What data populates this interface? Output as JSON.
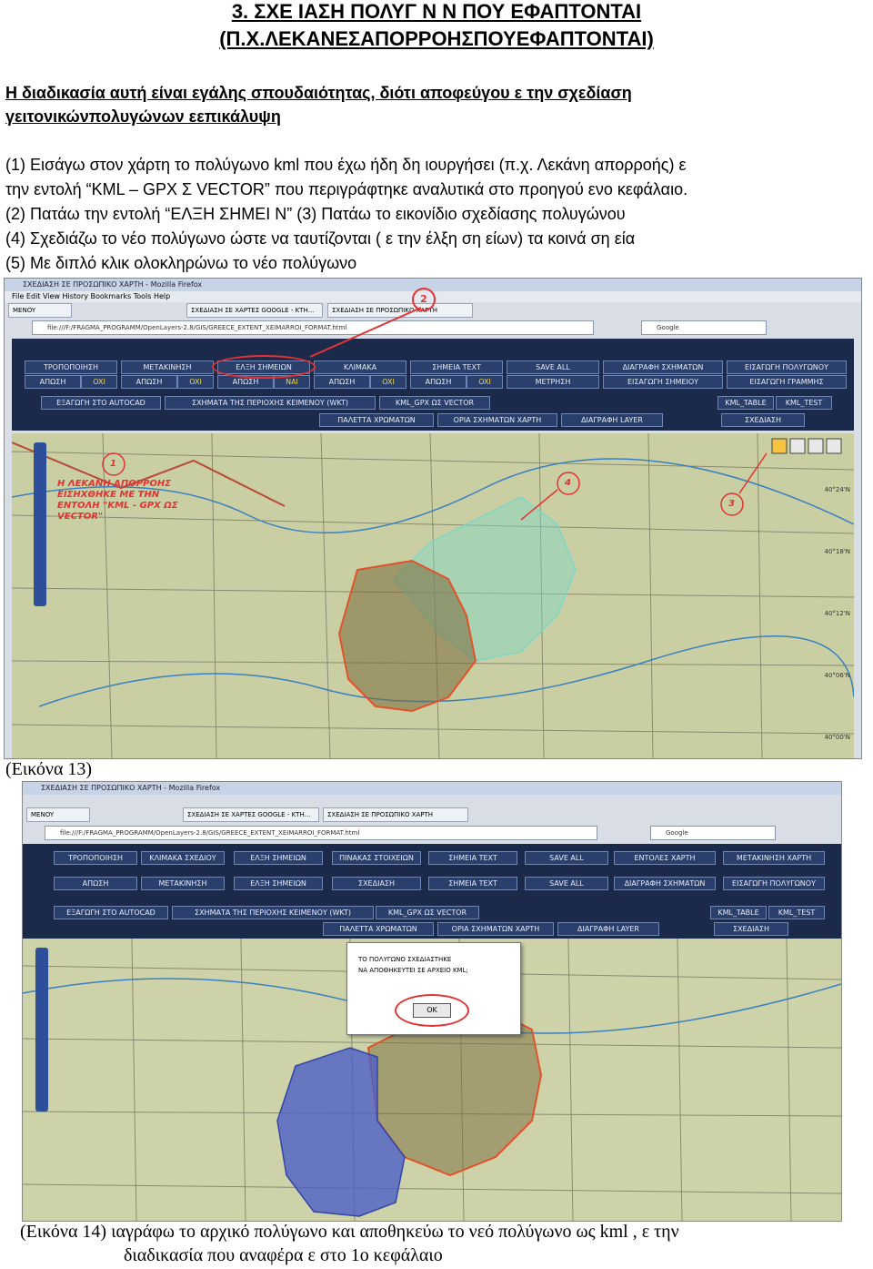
{
  "title": {
    "line1": "3. ΣΧΕ ΙΑΣΗ ΠΟΛΥΓ Ν Ν ΠΟΥ ΕΦΑΠΤΟΝΤΑΙ",
    "line2": "(Π.Χ.ΛΕΚΑΝΕΣΑΠΟΡΡΟΗΣΠΟΥΕΦΑΠΤΟΝΤΑΙ)"
  },
  "intro": {
    "line1": "Η διαδικασία αυτή είναι εγάλης σπουδαιότητας, διότι αποφεύγου ε την σχεδίαση",
    "line2": "γειτονικώνπολυγώνων εεπικάλυψη"
  },
  "steps": {
    "s1a": "(1) Εισάγω στον χάρτη το πολύγωνο kml που έχω ήδη δη ιουργήσει (π.χ. Λεκάνη απορροής) ε",
    "s1b": "την εντολή “KML – GPX Σ VECTOR” που περιγράφτηκε αναλυτικά στο προηγού ενο κεφάλαιο.",
    "s2": "(2) Πατάω την εντολή “ΕΛΞΗ ΣΗΜΕΙ Ν” (3) Πατάω το εικονίδιο σχεδίασης πολυγώνου",
    "s4": "(4) Σχεδιάζω το νέο πολύγωνο ώστε να ταυτίζονται ( ε την έλξη ση είων) τα κοινά ση εία",
    "s5": "(5) Με διπλό κλικ ολοκληρώνω το νέο πολύγωνο"
  },
  "shot1": {
    "window_title": "ΣΧΕΔΙΑΣΗ ΣΕ ΠΡΟΣΩΠΙΚΟ ΧΑΡΤΗ - Mozilla Firefox",
    "menu": "File  Edit  View  History  Bookmarks  Tools  Help",
    "tabs": [
      "MENOY",
      "ΣΧΕΔΙΑΣΗ ΣΕ ΧΑΡΤΕΣ GOOGLE - ΚΤΗ...",
      "ΣΧΕΔΙΑΣΗ ΣΕ ΠΡΟΣΩΠΙΚΟ ΧΑΡΤΗ"
    ],
    "url": "file:///F:/FRAGMA_PROGRAMM/OpenLayers-2.8/GIS/GREECE_EXTENT_XEIMARROI_FORMAT.html",
    "search_placeholder": "Google",
    "row1": [
      "ΤΡΟΠΟΠΟΙΗΣΗ",
      "ΜΕΤΑΚΙΝΗΣΗ",
      "ΕΛΞΗ ΣΗΜΕΙΩΝ",
      "ΚΛΙΜΑΚΑ",
      "ΣΗΜΕΙΑ TEXT",
      "SAVE ALL",
      "ΔΙΑΓΡΑΦΗ ΣΧΗΜΑΤΩΝ",
      "ΕΙΣΑΓΩΓΗ ΠΟΛΥΓΩΝΟΥ"
    ],
    "row2": [
      "ΑΠΩΣΗ",
      "ΑΠΩΣΗ",
      "ΑΠΩΣΗ",
      "ΑΠΩΣΗ",
      "ΑΠΩΣΗ",
      "ΜΕΤΡΗΣΗ",
      "ΕΙΣΑΓΩΓΗ ΣΗΜΕΙΟΥ",
      "ΕΙΣΑΓΩΓΗ ΓΡΑΜΜΗΣ"
    ],
    "row2_values": [
      "OXI",
      "OXI",
      "NAI",
      "OXI",
      "OXI"
    ],
    "row3": [
      "ΕΞΑΓΩΓΗ ΣΤΟ AUTOCAD",
      "ΣΧΗΜΑΤΑ ΤΗΣ ΠΕΡΙΟΧΗΣ ΚΕΙΜΕΝΟΥ (WKT)",
      "KML_GPX ΩΣ VECTOR",
      "KML_TABLE",
      "KML_TEST"
    ],
    "row4": [
      "ΠΑΛΕΤΤΑ ΧΡΩΜΑΤΩΝ",
      "ΟΡΙΑ ΣΧΗΜΑΤΩΝ ΧΑΡΤΗ",
      "ΔΙΑΓΡΑΦΗ LAYER",
      "ΣΧΕΔΙΑΣΗ"
    ],
    "map_label": "Η ΛΕΚΑΝΗ ΑΠΟΡΡΟΗΣ ΕΙΣΗΧΘΗΚΕ ΜΕ ΤΗΝ ΕΝΤΟΛΗ \"KML - GPX ΩΣ VECTOR\"",
    "map_label_lines": [
      "Η ΛΕΚΑΝΗ ΑΠΟΡΡΟΗΣ",
      "ΕΙΣΗΧΘΗΚΕ ΜΕ ΤΗΝ",
      "ΕΝΤΟΛΗ \"KML - GPX ΩΣ",
      "VECTOR\""
    ],
    "callouts": [
      "1",
      "2",
      "3",
      "4"
    ],
    "lat_ticks": [
      "40°24'N",
      "40°18'N",
      "40°12'N",
      "40°06'N",
      "40°00'N"
    ]
  },
  "caption13": "(Εικόνα 13)",
  "shot2": {
    "window_title": "ΣΧΕΔΙΑΣΗ ΣΕ ΠΡΟΣΩΠΙΚΟ ΧΑΡΤΗ - Mozilla Firefox",
    "tabs": [
      "MENOY",
      "ΣΧΕΔΙΑΣΗ ΣΕ ΧΑΡΤΕΣ GOOGLE - ΚΤΗ...",
      "ΣΧΕΔΙΑΣΗ ΣΕ ΠΡΟΣΩΠΙΚΟ ΧΑΡΤΗ"
    ],
    "url": "file:///F:/FRAGMA_PROGRAMM/OpenLayers-2.8/GIS/GREECE_EXTENT_XEIMARROI_FORMAT.html",
    "search_placeholder": "Google",
    "row1": [
      "ΤΡΟΠΟΠΟΙΗΣΗ",
      "ΚΛΙΜΑΚΑ ΣΧΕΔΙΟΥ",
      "ΕΛΞΗ ΣΗΜΕΙΩΝ",
      "ΠΙΝΑΚΑΣ ΣΤΟΙΧΕΙΩΝ",
      "ΣΗΜΕΙΑ TEXT",
      "SAVE ALL",
      "ΕΝΤΟΛΕΣ ΧΑΡΤΗ",
      "ΜΕΤΑΚΙΝΗΣΗ ΧΑΡΤΗ"
    ],
    "row2": [
      "ΑΠΩΣΗ",
      "ΜΕΤΑΚΙΝΗΣΗ",
      "ΕΛΞΗ ΣΗΜΕΙΩΝ",
      "ΣΧΕΔΙΑΣΗ",
      "ΣΗΜΕΙΑ TEXT",
      "SAVE ALL",
      "ΔΙΑΓΡΑΦΗ ΣΧΗΜΑΤΩΝ",
      "ΕΙΣΑΓΩΓΗ ΠΟΛΥΓΩΝΟΥ"
    ],
    "row3": [
      "ΕΞΑΓΩΓΗ ΣΤΟ AUTOCAD",
      "ΣΧΗΜΑΤΑ ΤΗΣ ΠΕΡΙΟΧΗΣ ΚΕΙΜΕΝΟΥ (WKT)",
      "KML_GPX ΩΣ VECTOR",
      "KML_TABLE",
      "KML_TEST"
    ],
    "row4": [
      "ΠΑΛΕΤΤΑ ΧΡΩΜΑΤΩΝ",
      "ΟΡΙΑ ΣΧΗΜΑΤΩΝ ΧΑΡΤΗ",
      "ΔΙΑΓΡΑΦΗ LAYER",
      "ΣΧΕΔΙΑΣΗ"
    ],
    "dialog_line1": "ΤΟ ΠΟΛΥΓΩΝΟ ΣΧΕΔΙΑΣΤΗΚΕ",
    "dialog_line2": "ΝΑ ΑΠΟΘΗΚΕΥΤΕΙ ΣΕ ΑΡΧΕΙΟ KML;",
    "dialog_ok": "OK"
  },
  "caption14": {
    "line1": "(Εικόνα 14)  ιαγράφω το αρχικό πολύγωνο και αποθηκεύω το νεό πολύγωνο ως kml ,  ε την",
    "line2": "διαδικασία που αναφέρα  ε στο 1ο κεφάλαιο"
  },
  "colors": {
    "panel": "#1b2a4a",
    "button": "#2a3f6b",
    "highlight": "#e13333",
    "polygon_old": "#7a6a3a",
    "polygon_cyan": "#7ed6c7",
    "polygon_blue": "#4d5fc7"
  }
}
